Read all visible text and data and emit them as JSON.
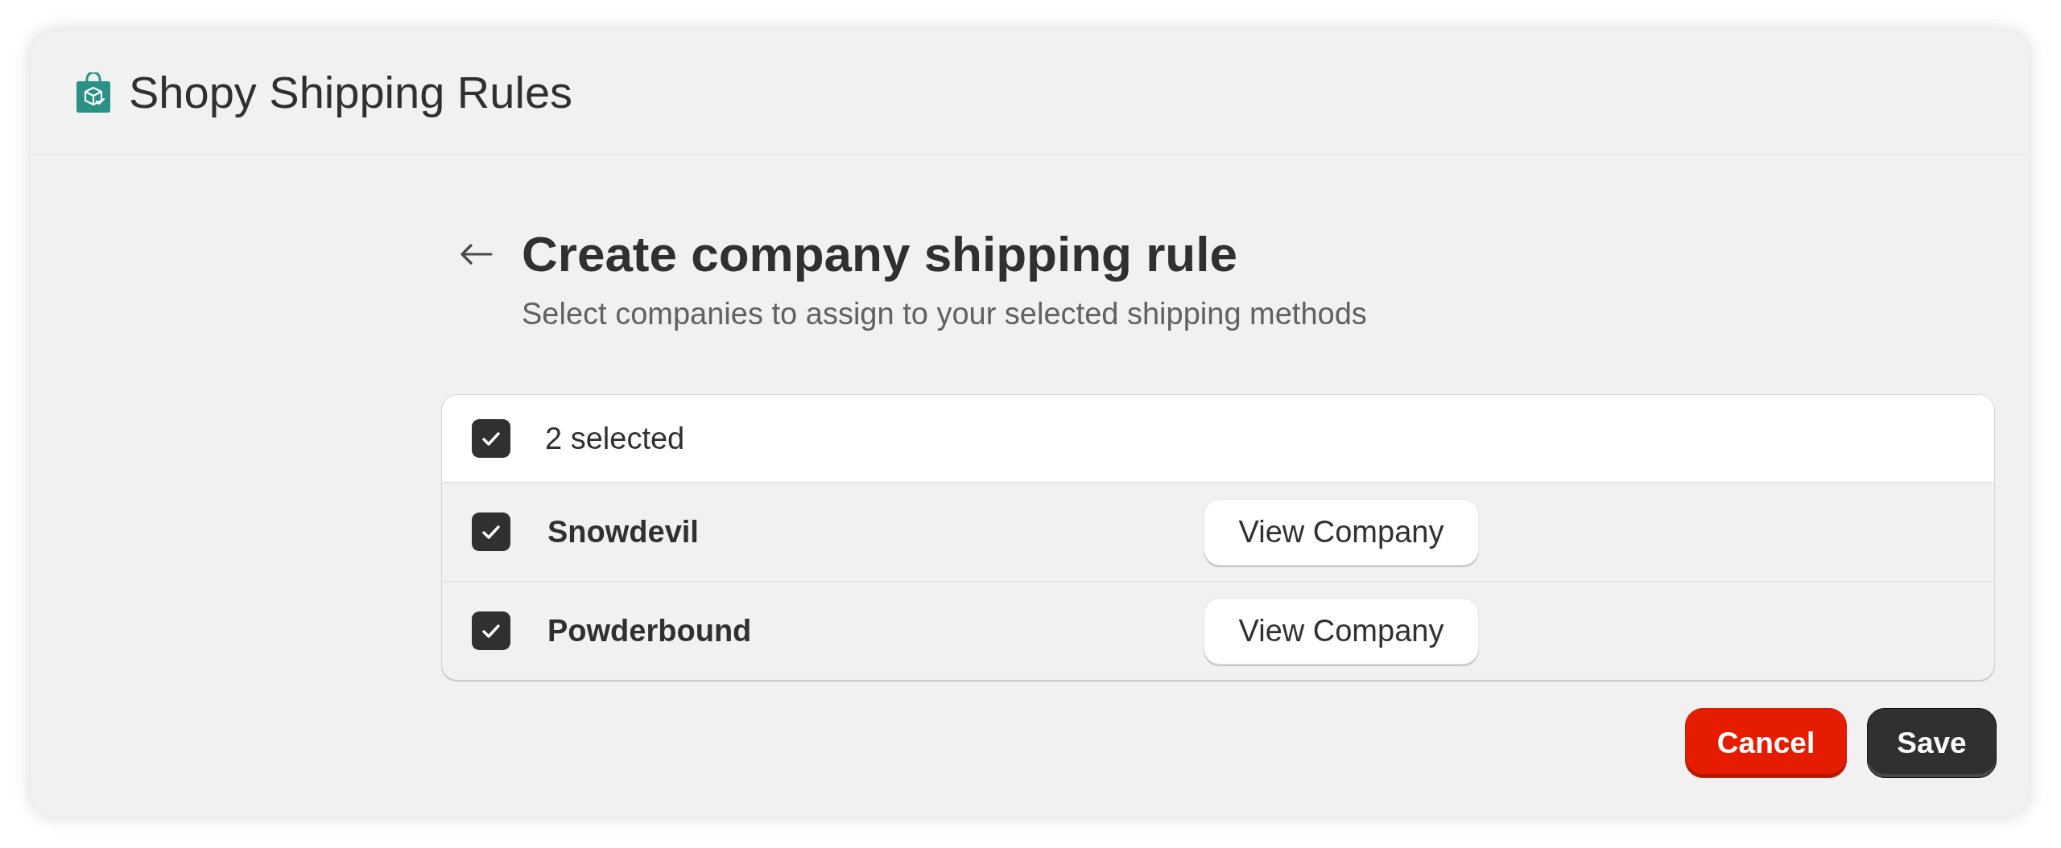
{
  "app": {
    "title": "Shopy Shipping Rules"
  },
  "page": {
    "title": "Create company shipping rule",
    "subtitle": "Select companies to assign to your selected shipping methods"
  },
  "selection": {
    "label": "2 selected",
    "checked": true
  },
  "companies": [
    {
      "name": "Snowdevil",
      "checked": true,
      "action": "View Company"
    },
    {
      "name": "Powderbound",
      "checked": true,
      "action": "View Company"
    }
  ],
  "buttons": [
    {
      "label": "Cancel",
      "kind": "critical"
    },
    {
      "label": "Save",
      "kind": "primary"
    }
  ]
}
